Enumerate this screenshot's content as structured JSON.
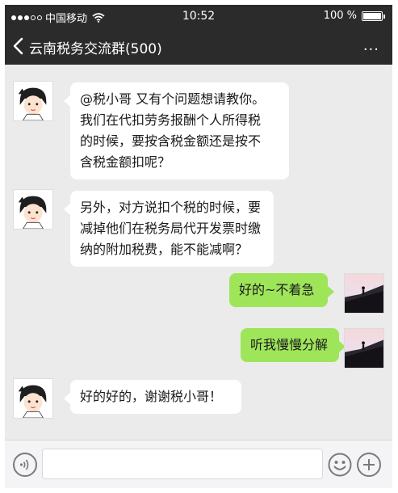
{
  "status_bar": {
    "carrier": "中国移动",
    "time": "10:52",
    "battery": "100 %",
    "battery_level": 1.0,
    "signal_bars_filled": 3,
    "signal_bars_total": 5
  },
  "header": {
    "title": "云南税务交流群(500)",
    "more_label": "..."
  },
  "messages": [
    {
      "direction": "incoming",
      "avatar": "cartoon-girl-avatar",
      "lines": [
        "@税小哥 又有个问题想请教你。",
        "我们在代扣劳务报酬个人所得税",
        "的时候，要按含税金额还是按不",
        "含税金额扣呢？"
      ]
    },
    {
      "direction": "incoming",
      "avatar": "cartoon-girl-avatar",
      "lines": [
        "另外，对方说扣个税的时候，要",
        "减掉他们在税务局代开发票时缴",
        "纳的附加税费，能不能减啊？"
      ]
    },
    {
      "direction": "outgoing",
      "avatar": "silhouette-landscape-avatar",
      "lines": [
        "好的~不着急"
      ]
    },
    {
      "direction": "outgoing",
      "avatar": "silhouette-landscape-avatar",
      "lines": [
        "听我慢慢分解"
      ]
    },
    {
      "direction": "incoming",
      "avatar": "cartoon-girl-avatar",
      "lines": [
        "好的好的，谢谢税小哥！"
      ]
    }
  ],
  "input_bar": {
    "voice_icon": "voice-icon",
    "emoji_icon": "emoji-icon",
    "plus_icon": "plus-icon"
  },
  "colors": {
    "bar": "#2b2b2b",
    "chat_bg": "#ebebeb",
    "incoming_bubble": "#ffffff",
    "outgoing_bubble": "#9fe55a"
  }
}
